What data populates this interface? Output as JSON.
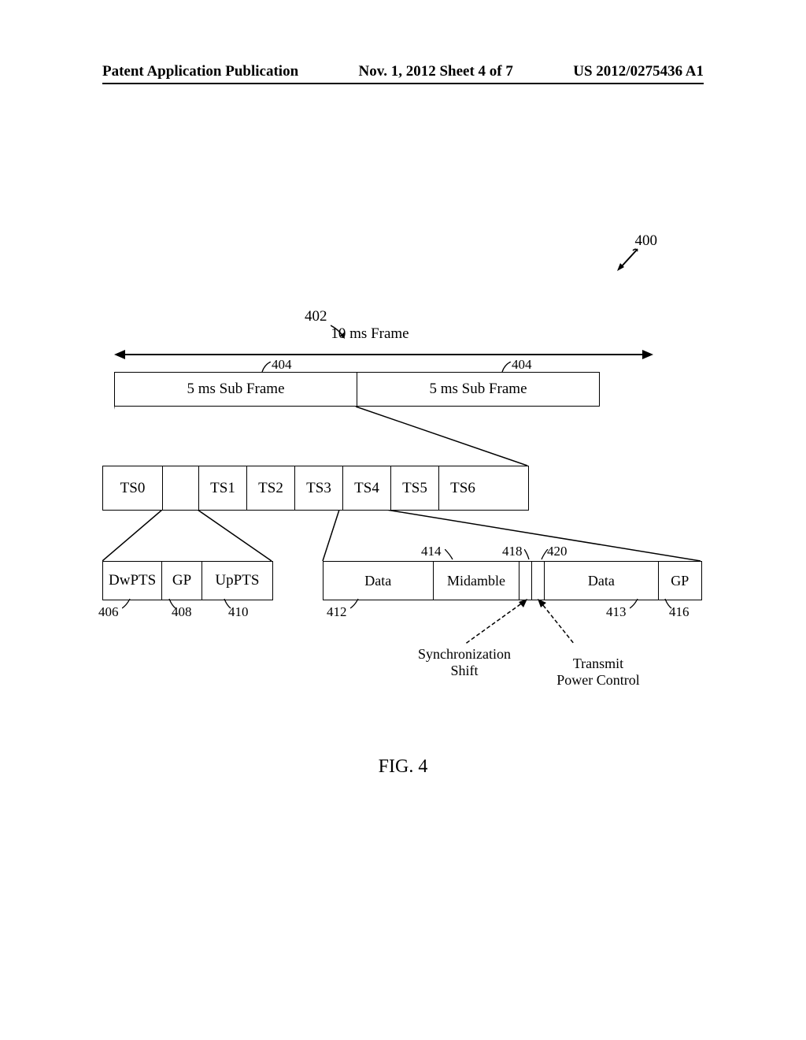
{
  "header": {
    "left": "Patent Application Publication",
    "center": "Nov. 1, 2012   Sheet 4 of 7",
    "right": "US 2012/0275436 A1"
  },
  "refs": {
    "r400": "400",
    "r402": "402",
    "r404": "404",
    "r406": "406",
    "r408": "408",
    "r410": "410",
    "r412": "412",
    "r413": "413",
    "r414": "414",
    "r416": "416",
    "r418": "418",
    "r420": "420"
  },
  "frame": {
    "label": "10 ms Frame",
    "subframe_label": "5 ms Sub Frame"
  },
  "timeslots": {
    "ts0": "TS0",
    "ts1": "TS1",
    "ts2": "TS2",
    "ts3": "TS3",
    "ts4": "TS4",
    "ts5": "TS5",
    "ts6": "TS6"
  },
  "special": {
    "dwpts": "DwPTS",
    "gp": "GP",
    "uppts": "UpPTS"
  },
  "dataslot": {
    "data": "Data",
    "midamble": "Midamble",
    "gp": "GP"
  },
  "annotations": {
    "sync_shift": "Synchronization\nShift",
    "tpc": "Transmit\nPower Control"
  },
  "figure": "FIG. 4",
  "chart_data": {
    "type": "table",
    "title": "TD-SCDMA Frame Structure (400)",
    "frame_duration_ms": 10,
    "subframe_duration_ms": 5,
    "subframes_per_frame": 2,
    "subframe_structure": [
      "TS0",
      "Special(DwPTS/GP/UpPTS)",
      "TS1",
      "TS2",
      "TS3",
      "TS4",
      "TS5",
      "TS6"
    ],
    "special_slot_components": [
      "DwPTS",
      "GP",
      "UpPTS"
    ],
    "special_slot_refs": {
      "DwPTS": 406,
      "GP": 408,
      "UpPTS": 410
    },
    "timeslot_structure": [
      "Data",
      "Midamble",
      "SynchronizationShift",
      "TransmitPowerControl",
      "Data",
      "GP"
    ],
    "timeslot_refs": {
      "Data1": 412,
      "Midamble": 414,
      "SynchronizationShift": 418,
      "TransmitPowerControl": 420,
      "Data2": 413,
      "GP": 416
    }
  }
}
